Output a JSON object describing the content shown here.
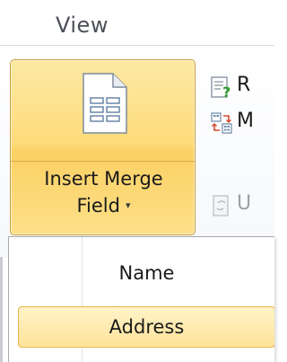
{
  "ribbon": {
    "tab_label": "View",
    "insert_merge_field": {
      "line1": "Insert Merge",
      "line2": "Field",
      "caret": "▾"
    },
    "small_items": [
      {
        "label": "R",
        "icon": "rules-icon",
        "disabled": false
      },
      {
        "label": "M",
        "icon": "match-fields-icon",
        "disabled": false
      },
      {
        "label": "U",
        "icon": "update-labels-icon",
        "disabled": true
      }
    ]
  },
  "dropdown": {
    "items": [
      {
        "label": "Name",
        "highlighted": false
      },
      {
        "label": "Address",
        "highlighted": true
      }
    ]
  },
  "colors": {
    "button_highlight": "#fddb7a",
    "button_border": "#c79a3b",
    "tab_text": "#4b5058"
  }
}
